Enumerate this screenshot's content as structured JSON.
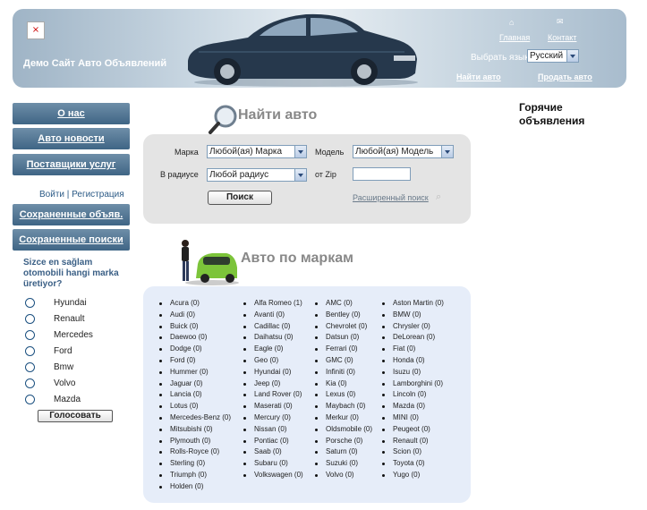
{
  "header": {
    "site_title": "Демо Сайт Авто Объявлений",
    "broken_image_glyph": "×",
    "home_label": "Главная",
    "contact_label": "Контакт",
    "lang_label": "Выбрать язык",
    "lang_value": "Русский",
    "find_car_link": "Найти авто",
    "sell_car_link": "Продать авто"
  },
  "nav": {
    "about": "О нас",
    "news": "Авто новости",
    "suppliers": "Поставщики услуг",
    "login": "Войти",
    "separator": "|",
    "register": "Регистрация",
    "saved_ads": "Сохраненные объяв.",
    "saved_searches": "Сохраненные поиски"
  },
  "poll": {
    "question": "Sizce en sağlam otomobili hangi marka üretiyor?",
    "options": [
      "Hyundai",
      "Renault",
      "Mercedes",
      "Ford",
      "Bmw",
      "Volvo",
      "Mazda"
    ],
    "vote_label": "Голосовать"
  },
  "search": {
    "title": "Найти авто",
    "make_label": "Марка",
    "make_value": "Любой(ая) Марка",
    "model_label": "Модель",
    "model_value": "Любой(ая) Модель",
    "radius_label": "В радиусе",
    "radius_value": "Любой радиус",
    "zip_label": "от Zip",
    "zip_value": "",
    "search_button": "Поиск",
    "advanced_link": "Расширенный поиск"
  },
  "brands": {
    "title": "Авто по маркам",
    "columns": [
      [
        "Acura (0)",
        "Audi (0)",
        "Buick (0)",
        "Daewoo (0)",
        "Dodge (0)",
        "Ford (0)",
        "Hummer (0)",
        "Jaguar (0)",
        "Lancia (0)",
        "Lotus (0)",
        "Mercedes-Benz (0)",
        "Mitsubishi (0)",
        "Plymouth (0)",
        "Rolls-Royce (0)",
        "Sterling (0)",
        "Triumph (0)",
        "Holden (0)"
      ],
      [
        "Alfa Romeo (1)",
        "Avanti (0)",
        "Cadillac (0)",
        "Daihatsu (0)",
        "Eagle (0)",
        "Geo (0)",
        "Hyundai (0)",
        "Jeep (0)",
        "Land Rover (0)",
        "Maserati (0)",
        "Mercury (0)",
        "Nissan (0)",
        "Pontiac (0)",
        "Saab (0)",
        "Subaru (0)",
        "Volkswagen (0)"
      ],
      [
        "AMC (0)",
        "Bentley (0)",
        "Chevrolet (0)",
        "Datsun (0)",
        "Ferrari (0)",
        "GMC (0)",
        "Infiniti (0)",
        "Kia (0)",
        "Lexus (0)",
        "Maybach (0)",
        "Merkur (0)",
        "Oldsmobile (0)",
        "Porsche (0)",
        "Saturn (0)",
        "Suzuki (0)",
        "Volvo (0)"
      ],
      [
        "Aston Martin (0)",
        "BMW (0)",
        "Chrysler (0)",
        "DeLorean (0)",
        "Fiat (0)",
        "Honda (0)",
        "Isuzu (0)",
        "Lamborghini (0)",
        "Lincoln (0)",
        "Mazda (0)",
        "MINI (0)",
        "Peugeot (0)",
        "Renault (0)",
        "Scion (0)",
        "Toyota (0)",
        "Yugo (0)"
      ]
    ]
  },
  "hot": {
    "title_line1": "Горячие",
    "title_line2": "объявления"
  },
  "colors": {
    "nav_button": "#4f7393",
    "search_panel": "#e4e4e4",
    "brands_panel": "#e6edf9"
  }
}
